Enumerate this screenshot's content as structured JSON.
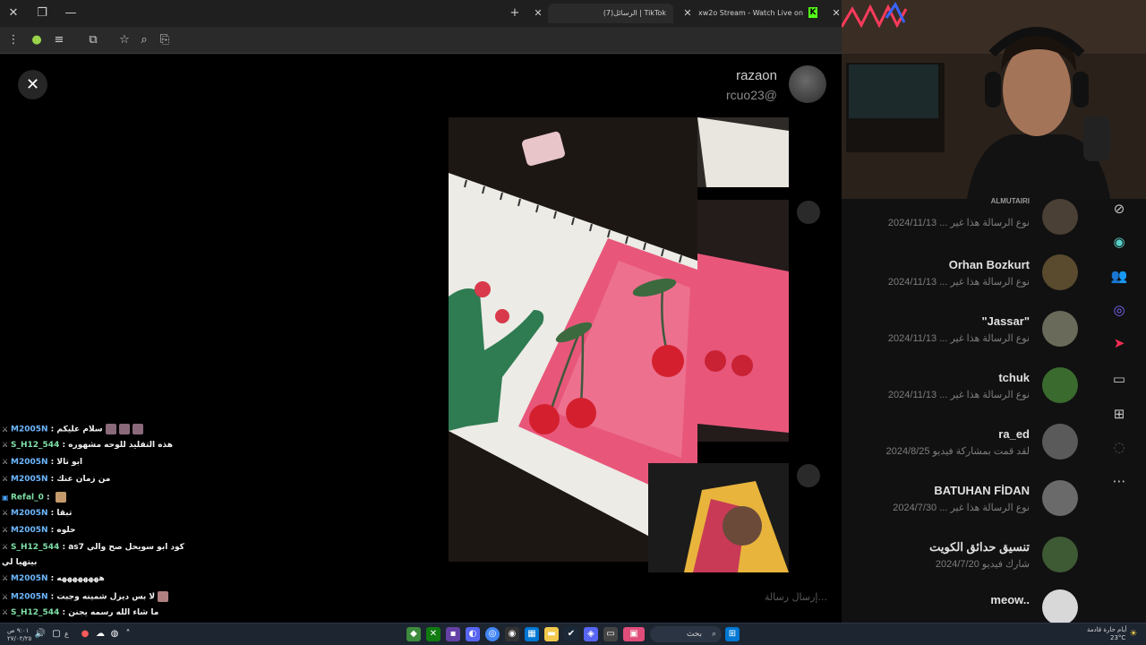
{
  "browser": {
    "tabs": [
      {
        "label": "(7)الرسائل | TikTok",
        "active": true
      },
      {
        "label": "xw2o Stream - Watch Live on Kick",
        "active": false
      }
    ],
    "kick_badge": "K"
  },
  "viewer": {
    "profile_name": "razaon",
    "profile_handle": "rcuo23@",
    "composer_placeholder": "إرسال رسالة..."
  },
  "chat": [
    {
      "user": "M2005N",
      "text": "سلام عليكم",
      "color": "blue"
    },
    {
      "user": "S_H12_544",
      "text": "هذه التقليد للوحه مشهوره",
      "color": "green"
    },
    {
      "user": "M2005N",
      "text": "ابو تالا",
      "color": "blue"
    },
    {
      "user": "M2005N",
      "text": "من زمان عنك",
      "color": "blue"
    },
    {
      "user": "Refal_0",
      "text": "",
      "color": "green"
    },
    {
      "user": "M2005N",
      "text": "تبقا",
      "color": "blue"
    },
    {
      "user": "M2005N",
      "text": "حلوه",
      "color": "blue"
    },
    {
      "user": "S_H12_544",
      "text": "as7 كود ابو سويحل صح والي",
      "color": "green"
    },
    {
      "user": "",
      "text": "بيتهيا لي",
      "color": "blue"
    },
    {
      "user": "M2005N",
      "text": "ههههههههه",
      "color": "blue"
    },
    {
      "user": "M2005N",
      "text": "لا بس ديزل شمينه وجبت",
      "color": "blue"
    },
    {
      "user": "S_H12_544",
      "text": "ما شاء الله رسمه يجنن",
      "color": "green"
    }
  ],
  "messages": [
    {
      "name": "ALMUTAIRI",
      "preview": "نوع الرسالة هذا غير ... 2024/11/13"
    },
    {
      "name": "Orhan Bozkurt",
      "preview": "نوع الرسالة هذا غير ... 2024/11/13"
    },
    {
      "name": "\"Jassar\"",
      "preview": "نوع الرسالة هذا غير ... 2024/11/13"
    },
    {
      "name": "tchuk",
      "preview": "نوع الرسالة هذا غير ... 2024/11/13"
    },
    {
      "name": "ra_ed",
      "preview": "لقد قمت بمشاركة فيديو 2024/8/25"
    },
    {
      "name": "BATUHAN FİDAN",
      "preview": "نوع الرسالة هذا غير ... 2024/7/30"
    },
    {
      "name": "تنسيق حدائق الكويت",
      "preview": "شارك فيديو 2024/7/20"
    },
    {
      "name": "meow..",
      "preview": ""
    }
  ],
  "taskbar": {
    "search_label": "بحث",
    "tray_time": "٩:٠١ ص",
    "tray_date": "٢٧/٠٢/٢٥",
    "weather": "أيام حارة قادمة",
    "temp": "23°C",
    "lang": "ع"
  },
  "colors": {
    "accent_kick": "#53fc18",
    "tiktok_red": "#fe2c55",
    "chat_blue": "#6db8ff",
    "chat_green": "#7fe0a6"
  }
}
